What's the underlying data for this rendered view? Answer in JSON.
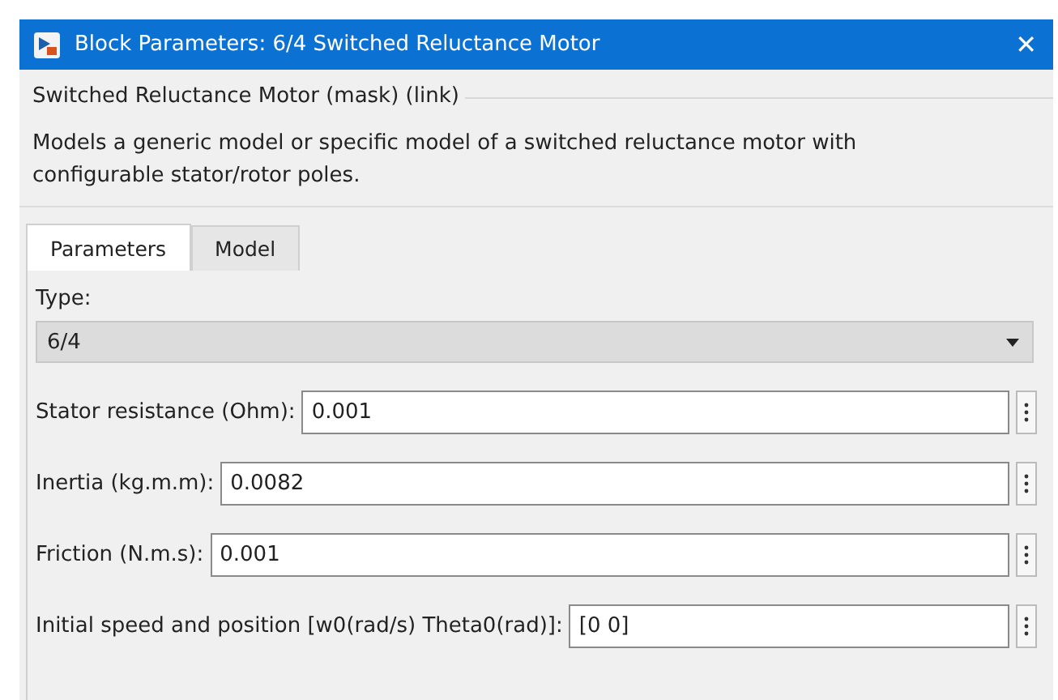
{
  "window": {
    "title": "Block Parameters: 6/4 Switched Reluctance Motor",
    "close": "✕"
  },
  "group": {
    "title": "Switched Reluctance Motor (mask) (link)",
    "description": "Models a generic model or specific model of a switched reluctance motor with configurable stator/rotor poles."
  },
  "tabs": [
    {
      "label": "Parameters",
      "selected": true
    },
    {
      "label": "Model",
      "selected": false
    }
  ],
  "type_field": {
    "label": "Type:",
    "value": "6/4"
  },
  "fields": [
    {
      "label": "Stator resistance (Ohm):",
      "value": "0.001"
    },
    {
      "label": "Inertia (kg.m.m):",
      "value": "0.0082"
    },
    {
      "label": "Friction (N.m.s):",
      "value": "0.001"
    },
    {
      "label": "Initial speed and position [w0(rad/s) Theta0(rad)]:",
      "value": "[0 0]"
    }
  ]
}
